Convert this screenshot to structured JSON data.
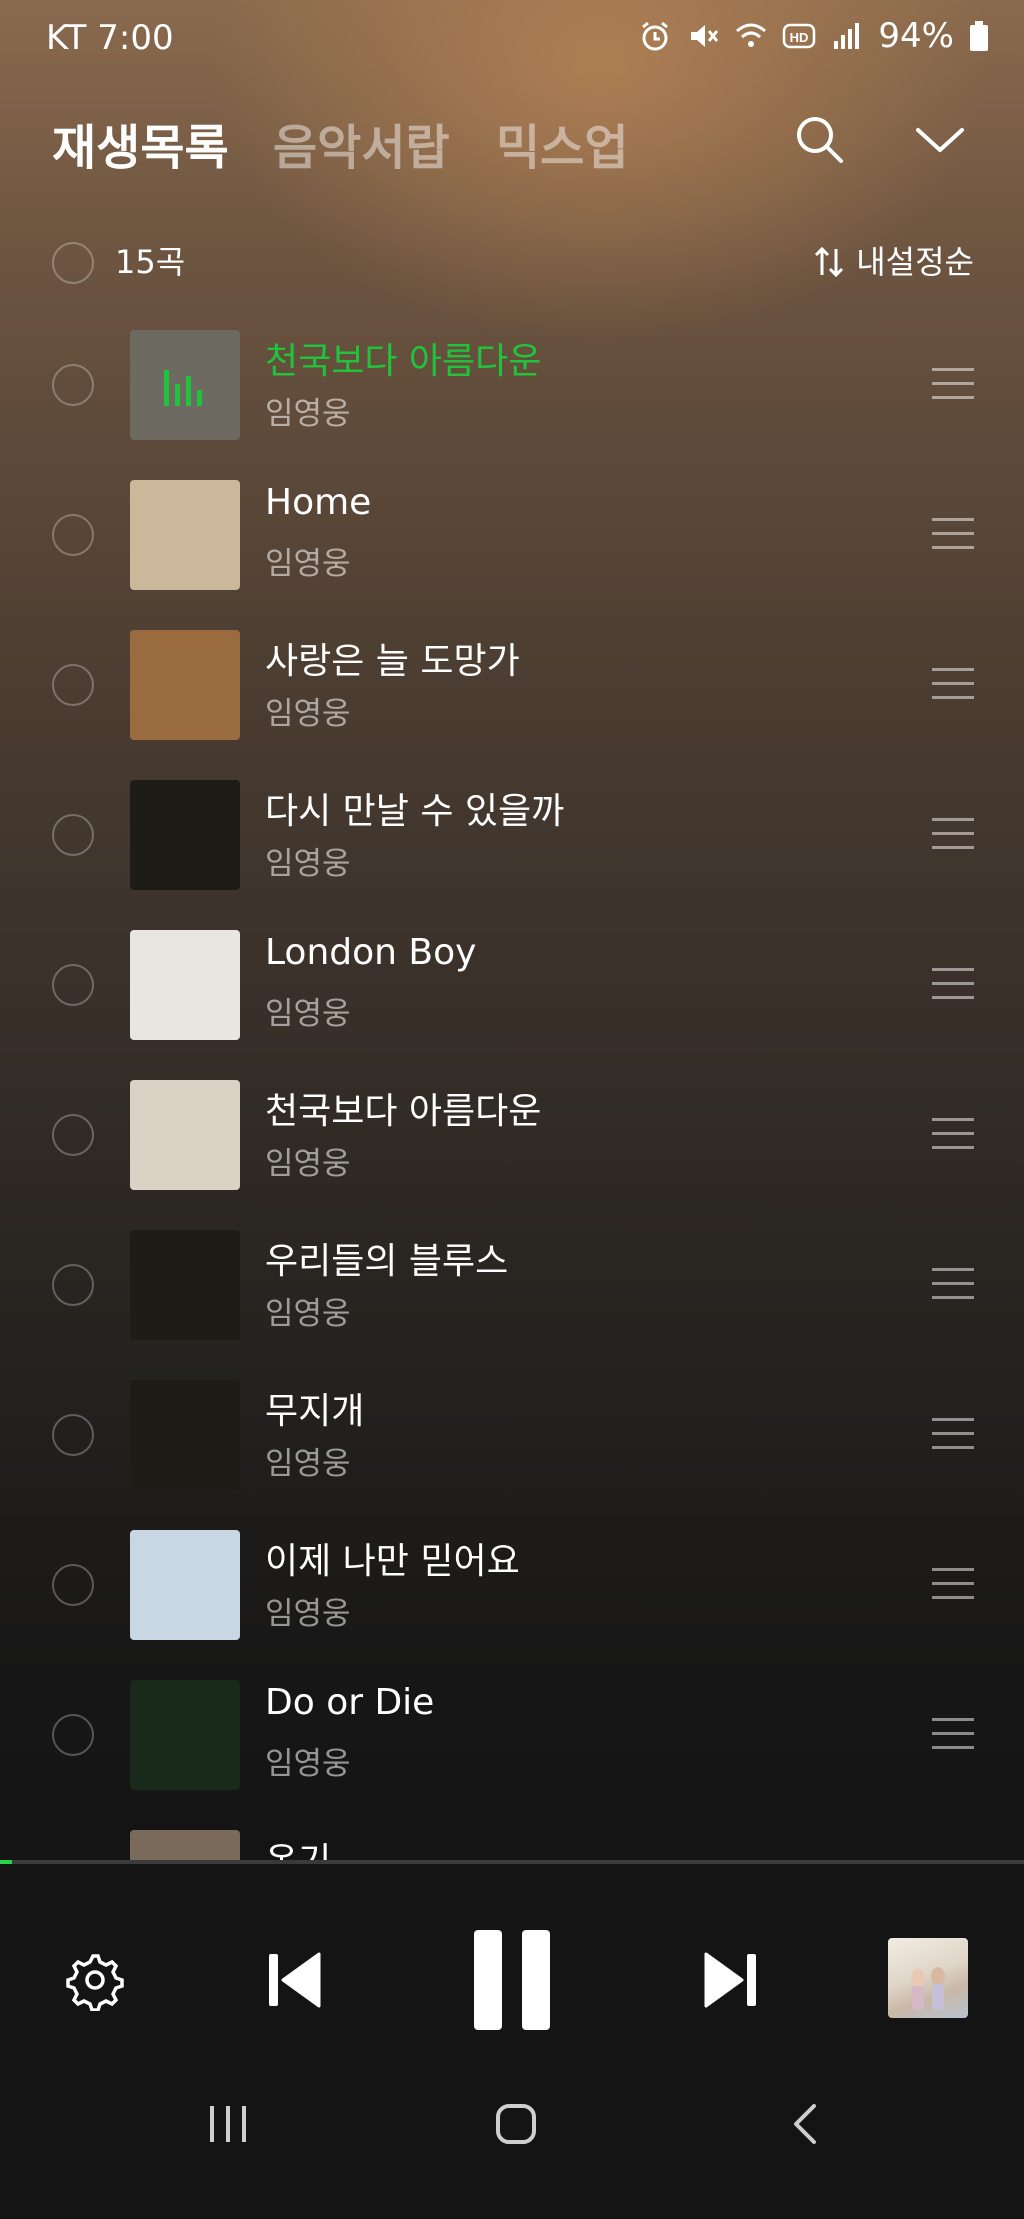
{
  "status_bar": {
    "carrier_time": "KT 7:00",
    "battery": "94%",
    "icons": [
      "alarm-icon",
      "mute-icon",
      "wifi-icon",
      "hd-voice-icon",
      "signal-icon",
      "battery-icon"
    ]
  },
  "tabs": [
    {
      "label": "재생목록",
      "active": true
    },
    {
      "label": "음악서랍",
      "active": false
    },
    {
      "label": "믹스업",
      "active": false
    }
  ],
  "header_icons": [
    "search-icon",
    "chevron-down-icon"
  ],
  "list_info": {
    "count": "15곡",
    "sort_label": "내설정순"
  },
  "colors": {
    "accent_green": "#21c33c",
    "progress_green": "#2ad24a",
    "background_dark": "#141414"
  },
  "tracks": [
    {
      "title": "천국보다 아름다운",
      "artist": "임영웅",
      "playing": true,
      "art": "#6d6a62"
    },
    {
      "title": "Home",
      "artist": "임영웅",
      "playing": false,
      "art": "#cbb79a"
    },
    {
      "title": "사랑은 늘 도망가",
      "artist": "임영웅",
      "playing": false,
      "art": "#9a6b3e"
    },
    {
      "title": "다시 만날 수 있을까",
      "artist": "임영웅",
      "playing": false,
      "art": "#1e1c16"
    },
    {
      "title": "London Boy",
      "artist": "임영웅",
      "playing": false,
      "art": "#e9e5df"
    },
    {
      "title": "천국보다 아름다운",
      "artist": "임영웅",
      "playing": false,
      "art": "#d9d2c5"
    },
    {
      "title": "우리들의 블루스",
      "artist": "임영웅",
      "playing": false,
      "art": "#1e1c16"
    },
    {
      "title": "무지개",
      "artist": "임영웅",
      "playing": false,
      "art": "#1e1c16"
    },
    {
      "title": "이제 나만 믿어요",
      "artist": "임영웅",
      "playing": false,
      "art": "#c9d6e4"
    },
    {
      "title": "Do or Die",
      "artist": "임영웅",
      "playing": false,
      "art": "#1a2a1a"
    },
    {
      "title": "온기",
      "artist": "",
      "playing": false,
      "art": "#7a6a5a"
    }
  ],
  "playback": {
    "progress_fraction": 0.012,
    "state": "playing",
    "controls": [
      "settings-icon",
      "previous-icon",
      "pause-icon",
      "next-icon",
      "album-art"
    ]
  },
  "system_nav": [
    "recents-icon",
    "home-icon",
    "back-icon"
  ]
}
